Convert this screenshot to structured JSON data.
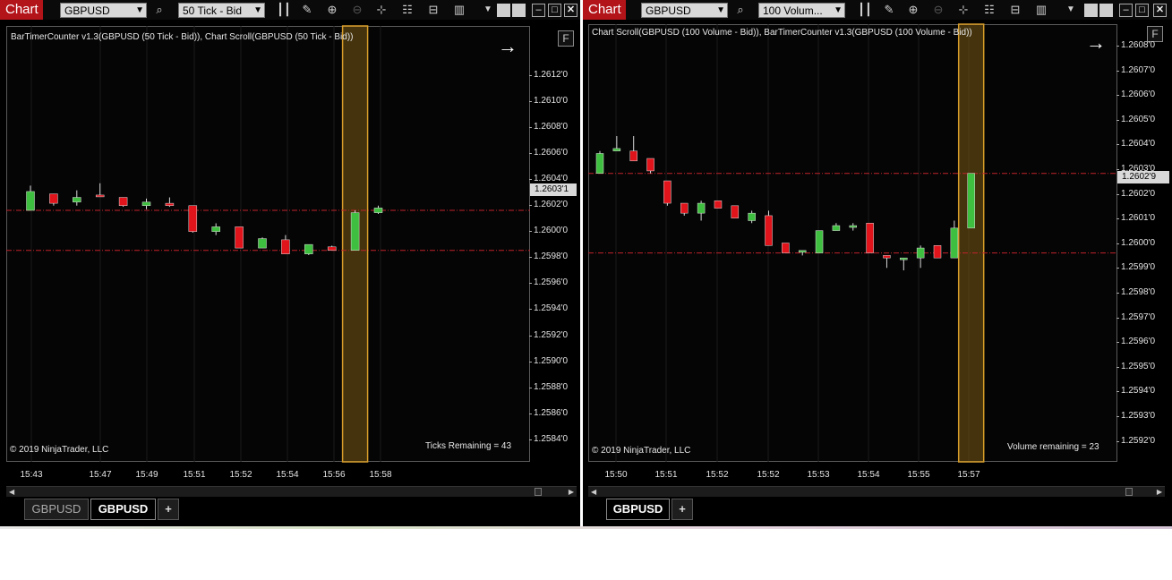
{
  "charts": [
    {
      "badge": "Chart",
      "instrument": "GBPUSD",
      "interval": "50 Tick - Bid",
      "title": "BarTimerCounter v1.3(GBPUSD (50 Tick - Bid)), Chart Scroll(GBPUSD (50 Tick - Bid))",
      "copyright": "© 2019 NinjaTrader, LLC",
      "counter_text": "Ticks Remaining = 43",
      "f_button": "F",
      "last_price": "1.2603'1",
      "y_ticks": [
        "1.2612'0",
        "1.2610'0",
        "1.2608'0",
        "1.2606'0",
        "1.2604'0",
        "1.2602'0",
        "1.2600'0",
        "1.2598'0",
        "1.2596'0",
        "1.2594'0",
        "1.2592'0",
        "1.2590'0",
        "1.2588'0",
        "1.2586'0",
        "1.2584'0"
      ],
      "x_ticks": [
        "15:43",
        "15:47",
        "15:49",
        "15:51",
        "15:52",
        "15:54",
        "15:56",
        "15:58"
      ],
      "tabs": [
        "GBPUSD",
        "GBPUSD",
        "+"
      ],
      "active_tab": 1,
      "chart_data": {
        "type": "candlestick",
        "y_range": [
          1.25825,
          1.2618
        ],
        "ref_lines": [
          1.26031,
          1.25997
        ],
        "highlight_bar": 14,
        "candles": [
          {
            "o": 1.26031,
            "h": 1.26052,
            "c": 1.26047,
            "l": 1.26031
          },
          {
            "o": 1.26045,
            "h": 1.26045,
            "c": 1.26037,
            "l": 1.26035
          },
          {
            "o": 1.26038,
            "h": 1.26048,
            "c": 1.26042,
            "l": 1.26035
          },
          {
            "o": 1.26044,
            "h": 1.26054,
            "c": 1.26043,
            "l": 1.26043
          },
          {
            "o": 1.26042,
            "h": 1.26042,
            "c": 1.26035,
            "l": 1.26034
          },
          {
            "o": 1.26035,
            "h": 1.26041,
            "c": 1.26038,
            "l": 1.26032
          },
          {
            "o": 1.26037,
            "h": 1.26042,
            "c": 1.26035,
            "l": 1.26034
          },
          {
            "o": 1.26035,
            "h": 1.26035,
            "c": 1.26013,
            "l": 1.26012
          },
          {
            "o": 1.26013,
            "h": 1.2602,
            "c": 1.26017,
            "l": 1.2601
          },
          {
            "o": 1.26017,
            "h": 1.26017,
            "c": 1.25999,
            "l": 1.25999
          },
          {
            "o": 1.25999,
            "h": 1.26008,
            "c": 1.26007,
            "l": 1.25999
          },
          {
            "o": 1.26006,
            "h": 1.2601,
            "c": 1.25994,
            "l": 1.25994
          },
          {
            "o": 1.25994,
            "h": 1.26002,
            "c": 1.26002,
            "l": 1.25993
          },
          {
            "o": 1.26,
            "h": 1.26001,
            "c": 1.25997,
            "l": 1.25997
          },
          {
            "o": 1.25997,
            "h": 1.26031,
            "c": 1.26029,
            "l": 1.25997
          },
          {
            "o": 1.26029,
            "h": 1.26035,
            "c": 1.26033,
            "l": 1.26028
          }
        ]
      }
    },
    {
      "badge": "Chart",
      "instrument": "GBPUSD",
      "interval": "100 Volum...",
      "title": "Chart Scroll(GBPUSD (100 Volume - Bid)), BarTimerCounter v1.3(GBPUSD (100 Volume - Bid))",
      "copyright": "© 2019 NinjaTrader, LLC",
      "counter_text": "Volume remaining = 23",
      "f_button": "F",
      "last_price": "1.2602'9",
      "y_ticks": [
        "1.2608'0",
        "1.2607'0",
        "1.2606'0",
        "1.2605'0",
        "1.2604'0",
        "1.2603'0",
        "1.2602'0",
        "1.2601'0",
        "1.2600'0",
        "1.2599'0",
        "1.2598'0",
        "1.2597'0",
        "1.2596'0",
        "1.2595'0",
        "1.2594'0",
        "1.2593'0",
        "1.2592'0"
      ],
      "x_ticks": [
        "15:50",
        "15:51",
        "15:52",
        "15:52",
        "15:53",
        "15:54",
        "15:55",
        "15:57"
      ],
      "tabs": [
        "GBPUSD",
        "+"
      ],
      "active_tab": 0,
      "chart_data": {
        "type": "candlestick",
        "y_range": [
          1.25913,
          1.26089
        ],
        "ref_lines": [
          1.26029,
          1.25997
        ],
        "highlight_bar": 22,
        "candles": [
          {
            "o": 1.26029,
            "h": 1.26038,
            "c": 1.26037,
            "l": 1.26029
          },
          {
            "o": 1.26038,
            "h": 1.26044,
            "c": 1.26039,
            "l": 1.26038
          },
          {
            "o": 1.26038,
            "h": 1.26044,
            "c": 1.26034,
            "l": 1.26034
          },
          {
            "o": 1.26035,
            "h": 1.26035,
            "c": 1.2603,
            "l": 1.26029
          },
          {
            "o": 1.26026,
            "h": 1.26026,
            "c": 1.26017,
            "l": 1.26016
          },
          {
            "o": 1.26017,
            "h": 1.26017,
            "c": 1.26013,
            "l": 1.26012
          },
          {
            "o": 1.26013,
            "h": 1.26018,
            "c": 1.26017,
            "l": 1.2601
          },
          {
            "o": 1.26018,
            "h": 1.26018,
            "c": 1.26015,
            "l": 1.26015
          },
          {
            "o": 1.26016,
            "h": 1.26016,
            "c": 1.26011,
            "l": 1.26011
          },
          {
            "o": 1.2601,
            "h": 1.26014,
            "c": 1.26013,
            "l": 1.26009
          },
          {
            "o": 1.26012,
            "h": 1.26014,
            "c": 1.26,
            "l": 1.26
          },
          {
            "o": 1.26001,
            "h": 1.26001,
            "c": 1.25997,
            "l": 1.25997
          },
          {
            "o": 1.25998,
            "h": 1.25998,
            "c": 1.25998,
            "l": 1.25996
          },
          {
            "o": 1.25997,
            "h": 1.26006,
            "c": 1.26006,
            "l": 1.25997
          },
          {
            "o": 1.26006,
            "h": 1.26009,
            "c": 1.26008,
            "l": 1.26006
          },
          {
            "o": 1.26008,
            "h": 1.26009,
            "c": 1.26008,
            "l": 1.26006
          },
          {
            "o": 1.26009,
            "h": 1.26009,
            "c": 1.25997,
            "l": 1.25997
          },
          {
            "o": 1.25996,
            "h": 1.25996,
            "c": 1.25995,
            "l": 1.25991
          },
          {
            "o": 1.25995,
            "h": 1.25995,
            "c": 1.25995,
            "l": 1.2599
          },
          {
            "o": 1.25995,
            "h": 1.26,
            "c": 1.25999,
            "l": 1.25991
          },
          {
            "o": 1.26,
            "h": 1.26,
            "c": 1.25995,
            "l": 1.25995
          },
          {
            "o": 1.25995,
            "h": 1.2601,
            "c": 1.26007,
            "l": 1.25995
          },
          {
            "o": 1.26007,
            "h": 1.26029,
            "c": 1.26029,
            "l": 1.26007
          }
        ]
      }
    }
  ]
}
